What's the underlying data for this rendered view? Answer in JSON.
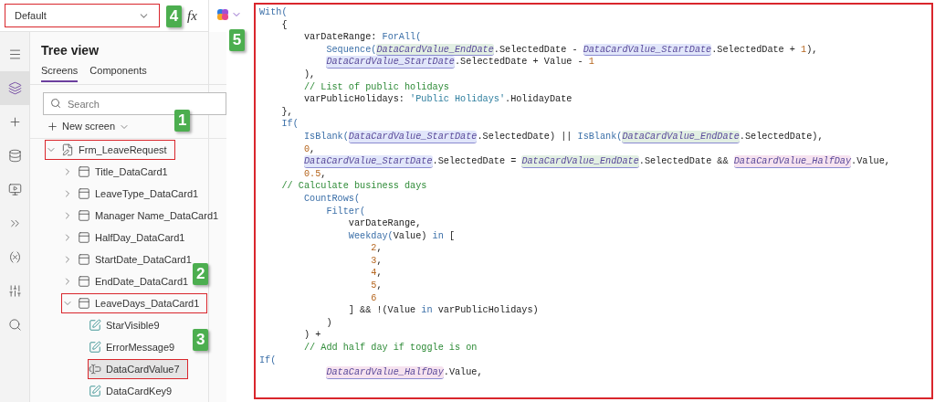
{
  "formula_bar": {
    "property": {
      "value": "Default",
      "highlighted": true
    },
    "formula_label": "fx",
    "callout": "4"
  },
  "rail": [
    {
      "selected": false
    },
    {
      "selected": true
    },
    {
      "selected": false
    },
    {
      "selected": false
    },
    {
      "selected": false
    },
    {
      "selected": false
    },
    {
      "selected": false
    },
    {
      "selected": false
    },
    {
      "selected": false
    }
  ],
  "tree": {
    "title": "Tree view",
    "tabs": [
      {
        "label": "Screens",
        "selected": true
      },
      {
        "label": "Components",
        "selected": false
      }
    ],
    "search": {
      "placeholder": "Search"
    },
    "new_screen": {
      "label": "New screen",
      "callout": "1"
    },
    "items": [
      {
        "label": "Frm_LeaveRequest",
        "kind": "form",
        "expanded": true,
        "highlighted": true,
        "selected": false,
        "children": [
          {
            "label": "Title_DataCard1",
            "kind": "card",
            "expanded": false,
            "highlighted": false,
            "selected": false
          },
          {
            "label": "LeaveType_DataCard1",
            "kind": "card",
            "expanded": false,
            "highlighted": false,
            "selected": false
          },
          {
            "label": "Manager Name_DataCard1",
            "kind": "card",
            "expanded": false,
            "highlighted": false,
            "selected": false
          },
          {
            "label": "HalfDay_DataCard1",
            "kind": "card",
            "expanded": false,
            "highlighted": false,
            "selected": false
          },
          {
            "label": "StartDate_DataCard1",
            "kind": "card",
            "expanded": false,
            "highlighted": false,
            "selected": false
          },
          {
            "label": "EndDate_DataCard1",
            "kind": "card",
            "expanded": false,
            "highlighted": false,
            "selected": false,
            "callout": "2"
          },
          {
            "label": "LeaveDays_DataCard1",
            "kind": "card",
            "expanded": true,
            "highlighted": true,
            "selected": false,
            "children": [
              {
                "label": "StarVisible9",
                "kind": "label",
                "highlighted": false,
                "selected": false
              },
              {
                "label": "ErrorMessage9",
                "kind": "label",
                "highlighted": false,
                "selected": false,
                "callout": "3"
              },
              {
                "label": "DataCardValue7",
                "kind": "input",
                "highlighted": true,
                "selected": true
              },
              {
                "label": "DataCardKey9",
                "kind": "label",
                "highlighted": false,
                "selected": false
              }
            ]
          }
        ]
      }
    ]
  },
  "code": {
    "callout": "5",
    "highlighted": true,
    "lines": [
      {
        "tokens": [
          {
            "kind": "fn",
            "t": "With("
          }
        ]
      },
      {
        "tokens": [
          {
            "kind": "plain",
            "t": "    {"
          }
        ]
      },
      {
        "tokens": [
          {
            "kind": "plain",
            "t": "        varDateRange: "
          },
          {
            "kind": "fn",
            "t": "ForAll("
          }
        ]
      },
      {
        "tokens": [
          {
            "kind": "fn",
            "t": "            Sequence("
          },
          {
            "kind": "ref",
            "t": "DataCardValue_EndDate",
            "color": "#e2efe3"
          },
          {
            "kind": "plain",
            "t": ".SelectedDate - "
          },
          {
            "kind": "ref",
            "t": "DataCardValue_StartDate",
            "color": "#e1e6fa"
          },
          {
            "kind": "plain",
            "t": ".SelectedDate + "
          },
          {
            "kind": "num",
            "t": "1"
          },
          {
            "kind": "plain",
            "t": "),"
          }
        ]
      },
      {
        "tokens": [
          {
            "kind": "ref",
            "t": "            DataCardValue_StartDate",
            "color": "#e1e6fa"
          },
          {
            "kind": "plain",
            "t": ".SelectedDate + Value - "
          },
          {
            "kind": "num",
            "t": "1"
          }
        ]
      },
      {
        "tokens": [
          {
            "kind": "plain",
            "t": "        ),"
          }
        ]
      },
      {
        "tokens": [
          {
            "kind": "comment",
            "t": "        // List of public holidays"
          }
        ]
      },
      {
        "tokens": [
          {
            "kind": "plain",
            "t": "        varPublicHolidays: "
          },
          {
            "kind": "str",
            "t": "'Public Holidays'"
          },
          {
            "kind": "plain",
            "t": ".HolidayDate"
          }
        ]
      },
      {
        "tokens": [
          {
            "kind": "plain",
            "t": "    },"
          }
        ]
      },
      {
        "tokens": [
          {
            "kind": "fn",
            "t": "    If("
          }
        ]
      },
      {
        "tokens": [
          {
            "kind": "fn",
            "t": "        IsBlank("
          },
          {
            "kind": "ref",
            "t": "DataCardValue_StartDate",
            "color": "#e1e6fa"
          },
          {
            "kind": "plain",
            "t": ".SelectedDate) || "
          },
          {
            "kind": "fn",
            "t": "IsBlank("
          },
          {
            "kind": "ref",
            "t": "DataCardValue_EndDate",
            "color": "#e2efe3"
          },
          {
            "kind": "plain",
            "t": ".SelectedDate),"
          }
        ]
      },
      {
        "tokens": [
          {
            "kind": "num",
            "t": "        0"
          },
          {
            "kind": "plain",
            "t": ","
          }
        ]
      },
      {
        "tokens": [
          {
            "kind": "ref",
            "t": "        DataCardValue_StartDate",
            "color": "#e1e6fa"
          },
          {
            "kind": "plain",
            "t": ".SelectedDate = "
          },
          {
            "kind": "ref",
            "t": "DataCardValue_EndDate",
            "color": "#e2efe3"
          },
          {
            "kind": "plain",
            "t": ".SelectedDate && "
          },
          {
            "kind": "ref",
            "t": "DataCardValue_HalfDay",
            "color": "#f6e2ef"
          },
          {
            "kind": "plain",
            "t": ".Value,"
          }
        ]
      },
      {
        "tokens": [
          {
            "kind": "num",
            "t": "        0.5"
          },
          {
            "kind": "plain",
            "t": ","
          }
        ]
      },
      {
        "tokens": [
          {
            "kind": "comment",
            "t": "    // Calculate business days"
          }
        ]
      },
      {
        "tokens": [
          {
            "kind": "fn",
            "t": "        CountRows("
          }
        ]
      },
      {
        "tokens": [
          {
            "kind": "fn",
            "t": "            Filter("
          }
        ]
      },
      {
        "tokens": [
          {
            "kind": "plain",
            "t": "                varDateRange,"
          }
        ]
      },
      {
        "tokens": [
          {
            "kind": "fn",
            "t": "                Weekday("
          },
          {
            "kind": "plain",
            "t": "Value) "
          },
          {
            "kind": "fn",
            "t": "in"
          },
          {
            "kind": "plain",
            "t": " ["
          }
        ]
      },
      {
        "tokens": [
          {
            "kind": "num",
            "t": "                    2"
          },
          {
            "kind": "plain",
            "t": ","
          }
        ]
      },
      {
        "tokens": [
          {
            "kind": "num",
            "t": "                    3"
          },
          {
            "kind": "plain",
            "t": ","
          }
        ]
      },
      {
        "tokens": [
          {
            "kind": "num",
            "t": "                    4"
          },
          {
            "kind": "plain",
            "t": ","
          }
        ]
      },
      {
        "tokens": [
          {
            "kind": "num",
            "t": "                    5"
          },
          {
            "kind": "plain",
            "t": ","
          }
        ]
      },
      {
        "tokens": [
          {
            "kind": "num",
            "t": "                    6"
          }
        ]
      },
      {
        "tokens": [
          {
            "kind": "plain",
            "t": "                ] && !(Value "
          },
          {
            "kind": "fn",
            "t": "in"
          },
          {
            "kind": "plain",
            "t": " varPublicHolidays)"
          }
        ]
      },
      {
        "tokens": [
          {
            "kind": "plain",
            "t": "            )"
          }
        ]
      },
      {
        "tokens": [
          {
            "kind": "plain",
            "t": "        ) +"
          }
        ]
      },
      {
        "tokens": [
          {
            "kind": "comment",
            "t": "        // Add half day if toggle is on"
          }
        ]
      },
      {
        "tokens": [
          {
            "kind": "fn",
            "t": "If("
          }
        ]
      },
      {
        "tokens": [
          {
            "kind": "ref",
            "t": "            DataCardValue_HalfDay",
            "color": "#f6e2ef"
          },
          {
            "kind": "plain",
            "t": ".Value,"
          }
        ]
      }
    ]
  }
}
